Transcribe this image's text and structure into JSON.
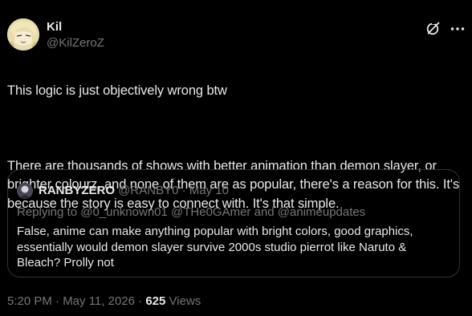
{
  "author": {
    "name": "Kil",
    "handle": "@KilZeroZ"
  },
  "icons": {
    "grok": "grok-slash-icon",
    "more": "more-dots-icon"
  },
  "tweet": {
    "text_line1": "This logic is just objectively wrong btw",
    "text_para2": "There are thousands of shows with better animation than demon slayer, or brighter colourz, and none of them are as popular, there's a reason for this. It's because the story is easy to connect with. It's that simple."
  },
  "quote": {
    "name": "RANBYZERO",
    "handle": "@RANBY0",
    "separator": "·",
    "date": "May 10",
    "replying_to": "Replying to @0_unknown01 @THe0GAmer and @animeupdates",
    "text": "False, anime can make anything popular with bright colors, good graphics, essentially would demon slayer survive 2000s studio pierrot like Naruto & Bleach? Prolly not"
  },
  "meta": {
    "timestamp": "5:20 PM · May 11, 2026",
    "separator": "·",
    "views_count": "625",
    "views_label": "Views"
  },
  "colors": {
    "background": "#000000",
    "text": "#e7e9ea",
    "secondary": "#71767b",
    "border": "#2f3336"
  }
}
